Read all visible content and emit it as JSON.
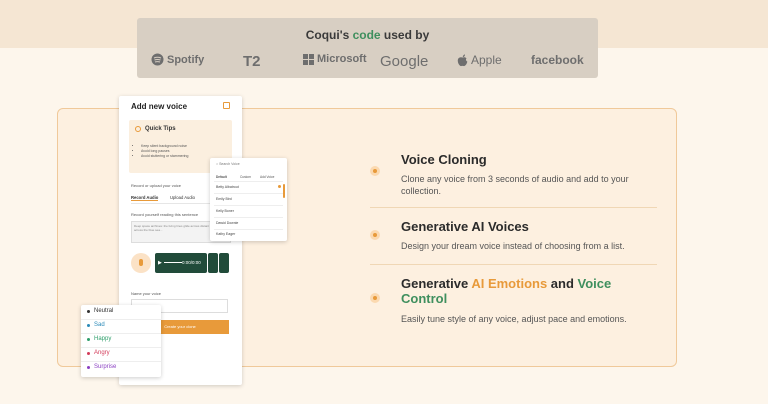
{
  "trusted": {
    "prefix": "Coqui's ",
    "highlight": "code",
    "suffix": " used by",
    "logos": [
      {
        "name": "Spotify",
        "icon": "spotify-icon"
      },
      {
        "name": "T2",
        "icon": "t2-logo"
      },
      {
        "name": "Microsoft",
        "icon": "microsoft-icon"
      },
      {
        "name": "Google",
        "icon": "google-logo"
      },
      {
        "name": "Apple",
        "icon": "apple-icon"
      },
      {
        "name": "facebook",
        "icon": "facebook-logo"
      }
    ]
  },
  "modal": {
    "title": "Add new voice",
    "close_icon": "close-icon",
    "tips_title": "Quick Tips",
    "tips": [
      "Keep silent background noise",
      "Avoid long pauses",
      "Avoid stuttering or stammering"
    ],
    "record_label": "Record or upload your voice",
    "tab_record": "Record Audio",
    "tab_upload": "Upload Audio",
    "sentence_label": "Record yourself reading this sentence",
    "sentence_text": "Deep space archives: the living lines glide across distant stars and across the blue sea...",
    "time": "0:00/0:00",
    "name_label": "Name your voice",
    "create_label": "Create your clone"
  },
  "voice_dropdown": {
    "search_placeholder": "Search Voice",
    "tabs": [
      "Default",
      "Custom",
      "Add Voice"
    ],
    "voices": [
      "Betty Albatrout",
      "Emily Bird",
      "Kelly Boner",
      "Dawid Downie",
      "Kathy Eager"
    ]
  },
  "emotions": [
    {
      "label": "Neutral",
      "color": "#333333"
    },
    {
      "label": "Sad",
      "color": "#2a8ab8"
    },
    {
      "label": "Happy",
      "color": "#2e9e6a"
    },
    {
      "label": "Angry",
      "color": "#d33c5a"
    },
    {
      "label": "Surprise",
      "color": "#8a3fc2"
    }
  ],
  "features": [
    {
      "title": "Voice Cloning",
      "desc": "Clone any voice from 3 seconds of audio and add to your collection."
    },
    {
      "title": "Generative AI Voices",
      "desc": "Design your dream voice instead of choosing from a list."
    },
    {
      "title_pre": "Generative ",
      "title_hl1": "AI Emotions",
      "title_mid": " and ",
      "title_hl2": "Voice Control",
      "desc": "Easily tune style of any voice, adjust pace and emotions."
    }
  ],
  "colors": {
    "accent": "#e89a3a",
    "brand_green": "#3f8f5e"
  }
}
